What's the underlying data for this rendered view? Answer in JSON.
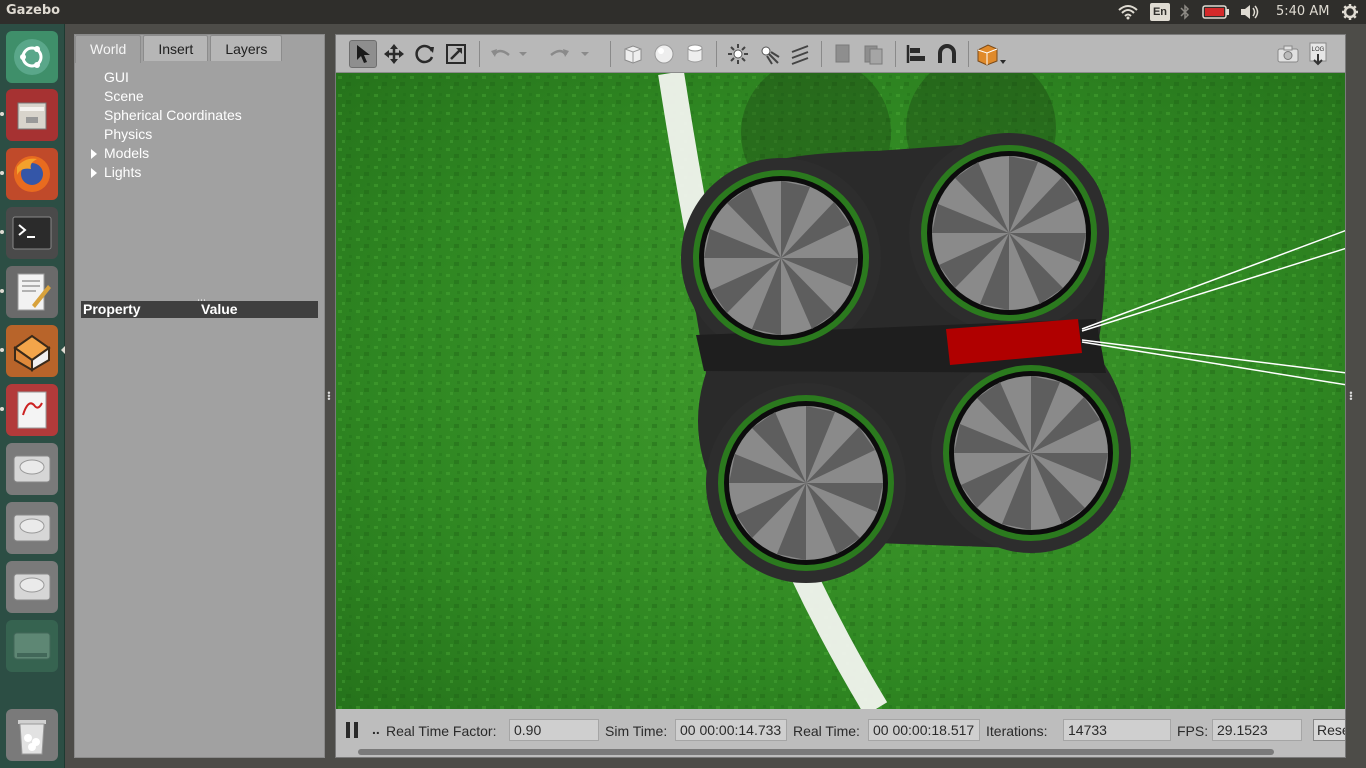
{
  "top_panel": {
    "app_name": "Gazebo",
    "keyboard_layout": "En",
    "clock": "5:40 AM",
    "icons": [
      "wifi-icon",
      "keyboard-layout-indicator",
      "bluetooth-icon",
      "battery-icon",
      "volume-icon",
      "settings-gear-icon"
    ]
  },
  "launcher": {
    "items": [
      "ubuntu-dash-icon",
      "files-icon",
      "firefox-icon",
      "terminal-icon",
      "text-editor-icon",
      "gazebo-icon",
      "document-viewer-icon",
      "drive-icon",
      "drive-icon",
      "drive-icon",
      "drive-icon",
      "trash-icon"
    ]
  },
  "left_panel": {
    "tabs": [
      {
        "label": "World",
        "active": true
      },
      {
        "label": "Insert",
        "active": false
      },
      {
        "label": "Layers",
        "active": false
      }
    ],
    "tree": [
      {
        "label": "GUI",
        "expandable": false
      },
      {
        "label": "Scene",
        "expandable": false
      },
      {
        "label": "Spherical Coordinates",
        "expandable": false
      },
      {
        "label": "Physics",
        "expandable": false
      },
      {
        "label": "Models",
        "expandable": true
      },
      {
        "label": "Lights",
        "expandable": true
      }
    ],
    "property_header": {
      "property": "Property",
      "value": "Value"
    }
  },
  "toolbar": {
    "tools": [
      "select-mode-icon",
      "translate-mode-icon",
      "rotate-mode-icon",
      "scale-mode-icon",
      "undo-icon",
      "redo-icon",
      "box-shape-icon",
      "sphere-shape-icon",
      "cylinder-shape-icon",
      "point-light-icon",
      "spot-light-icon",
      "directional-light-icon",
      "copy-icon",
      "paste-icon",
      "align-icon",
      "snap-icon",
      "view-angle-icon",
      "screenshot-icon",
      "log-icon"
    ]
  },
  "bottom_bar": {
    "ellipsis": "..",
    "real_time_factor_label": "Real Time Factor:",
    "real_time_factor": "0.90",
    "sim_time_label": "Sim Time:",
    "sim_time": "00 00:00:14.733",
    "real_time_label": "Real Time:",
    "real_time": "00 00:00:18.517",
    "iterations_label": "Iterations:",
    "iterations": "14733",
    "fps_label": "FPS:",
    "fps": "29.1523",
    "reset_label": "Reset"
  },
  "colors": {
    "ground": "#3f8f2a",
    "drone_body": "#2b2b2b",
    "sensor": "#b00000",
    "toolbar": "#b8b8b8"
  }
}
